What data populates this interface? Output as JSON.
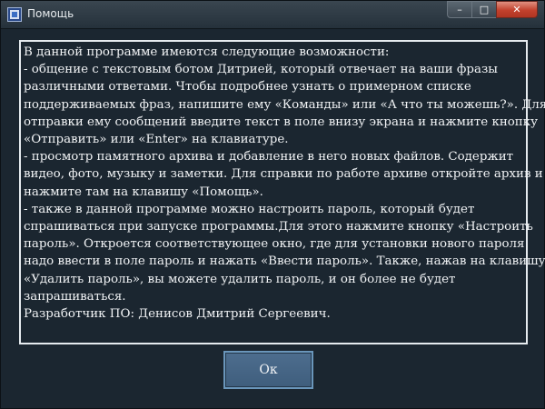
{
  "window": {
    "title": "Помощь",
    "controls": {
      "minimize": "–",
      "maximize": "□",
      "close": "✕"
    }
  },
  "help_lines": [
    "В данной программе имеются следующие возможности:",
    "- общение с текстовым ботом Дитрией, который отвечает на ваши фразы",
    "различными ответами. Чтобы подробнее узнать о примерном списке",
    "поддерживаемых фраз, напишите ему «Команды» или «А что ты можешь?». Для",
    "отправки ему сообщений введите текст в поле внизу экрана и нажмите кнопку",
    "«Отправить» или «Enter» на клавиатуре.",
    "- просмотр памятного архива и добавление в него новых файлов. Содержит",
    "видео, фото, музыку и заметки. Для справки по работе архиве откройте архив и",
    "нажмите там на клавишу «Помощь».",
    "- также в данной программе можно настроить пароль, который будет",
    "спрашиваться при запуске программы.Для этого нажмите кнопку «Настроить",
    "пароль». Откроется соответствующее окно, где для установки нового пароля",
    "надо ввести в поле пароль и нажать «Ввести пароль». Также, нажав на клавишу",
    "«Удалить пароль», вы можете удалить пароль, и он более не будет",
    "запрашиваться.",
    "Разработчик ПО: Денисов Дмитрий Сергеевич."
  ],
  "ok_button": {
    "label": "Ок"
  }
}
